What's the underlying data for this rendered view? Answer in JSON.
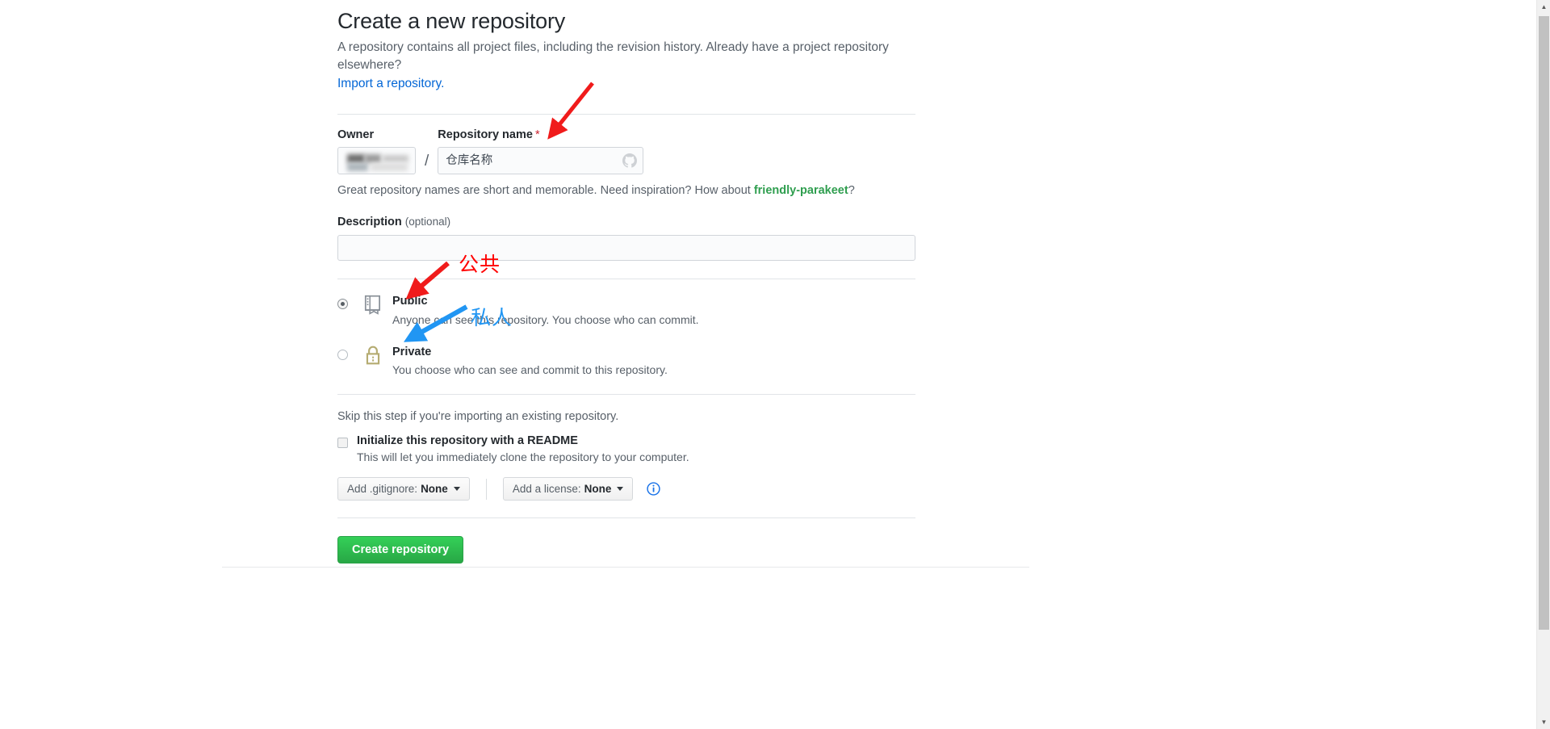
{
  "header": {
    "title": "Create a new repository",
    "subtitle": "A repository contains all project files, including the revision history. Already have a project repository elsewhere?",
    "import_link": "Import a repository."
  },
  "owner": {
    "label": "Owner",
    "value": "",
    "separator": "/"
  },
  "repository_name": {
    "label": "Repository name",
    "required_marker": "*",
    "placeholder": "仓库名称",
    "value": "",
    "icon": "github-mark-icon"
  },
  "name_hint": {
    "prefix": "Great repository names are short and memorable. Need inspiration? How about ",
    "suggestion": "friendly-parakeet",
    "suffix": "?"
  },
  "description": {
    "label": "Description",
    "optional": "(optional)",
    "value": "",
    "placeholder": ""
  },
  "visibility": {
    "selected": "public",
    "options": [
      {
        "id": "public",
        "title": "Public",
        "description": "Anyone can see this repository. You choose who can commit.",
        "icon": "repo-book-icon",
        "checked": true
      },
      {
        "id": "private",
        "title": "Private",
        "description": "You choose who can see and commit to this repository.",
        "icon": "lock-icon",
        "checked": false
      }
    ]
  },
  "initialize": {
    "skip_text": "Skip this step if you're importing an existing repository.",
    "readme_label": "Initialize this repository with a README",
    "readme_description": "This will let you immediately clone the repository to your computer.",
    "readme_checked": false,
    "gitignore": {
      "label": "Add .gitignore:",
      "value": "None"
    },
    "license": {
      "label": "Add a license:",
      "value": "None"
    },
    "info_icon": "info-circle-icon"
  },
  "actions": {
    "create_label": "Create repository",
    "create_color": "#28a745"
  },
  "annotations": [
    {
      "text": "公共",
      "color": "#ff0000",
      "points_to": "Public"
    },
    {
      "text": "私人",
      "color": "#2196f3",
      "points_to": "Private"
    }
  ],
  "scrollbar": {
    "up_arrow": "▲",
    "down_arrow": "▼"
  }
}
